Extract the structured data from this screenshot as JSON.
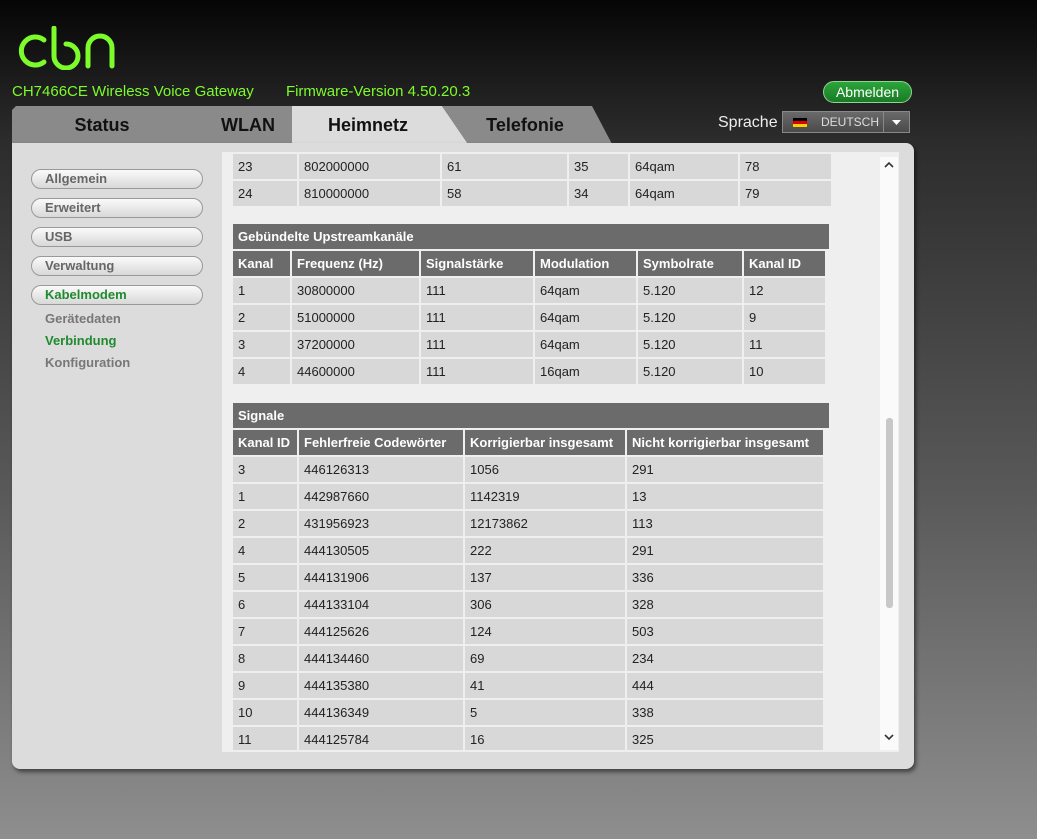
{
  "colors": {
    "brand": "#7cfc2a",
    "active_green": "#1f8a2e",
    "header_gray": "#6b6b6b",
    "cell_gray": "#d8d8d8"
  },
  "header": {
    "model": "CH7466CE  Wireless Voice Gateway",
    "firmware": "Firmware-Version  4.50.20.3",
    "logout_label": "Abmelden",
    "language_label": "Sprache",
    "language_value": "DEUTSCH",
    "flag_icon": "german-flag-icon"
  },
  "tabs": [
    {
      "label": "Status"
    },
    {
      "label": "WLAN"
    },
    {
      "label": "Heimnetz"
    },
    {
      "label": "Telefonie"
    }
  ],
  "sidebar": {
    "items": [
      {
        "label": "Allgemein"
      },
      {
        "label": "Erweitert"
      },
      {
        "label": "USB"
      },
      {
        "label": "Verwaltung"
      },
      {
        "label": "Kabelmodem"
      }
    ],
    "subitems": [
      {
        "label": "Gerätedaten"
      },
      {
        "label": "Verbindung"
      },
      {
        "label": "Konfiguration"
      }
    ]
  },
  "downstream_rows": [
    [
      "23",
      "802000000",
      "61",
      "35",
      "64qam",
      "78"
    ],
    [
      "24",
      "810000000",
      "58",
      "34",
      "64qam",
      "79"
    ]
  ],
  "upstream": {
    "caption": "Gebündelte Upstreamkanäle",
    "headers": [
      "Kanal",
      "Frequenz (Hz)",
      "Signalstärke",
      "Modulation",
      "Symbolrate",
      "Kanal ID"
    ],
    "rows": [
      [
        "1",
        "30800000",
        "111",
        "64qam",
        "5.120",
        "12"
      ],
      [
        "2",
        "51000000",
        "111",
        "64qam",
        "5.120",
        "9"
      ],
      [
        "3",
        "37200000",
        "111",
        "64qam",
        "5.120",
        "11"
      ],
      [
        "4",
        "44600000",
        "111",
        "16qam",
        "5.120",
        "10"
      ]
    ]
  },
  "signals": {
    "caption": "Signale",
    "headers": [
      "Kanal ID",
      "Fehlerfreie Codewörter",
      "Korrigierbar insgesamt",
      "Nicht korrigierbar insgesamt"
    ],
    "rows": [
      [
        "3",
        "446126313",
        "1056",
        "291"
      ],
      [
        "1",
        "442987660",
        "1142319",
        "13"
      ],
      [
        "2",
        "431956923",
        "12173862",
        "113"
      ],
      [
        "4",
        "444130505",
        "222",
        "291"
      ],
      [
        "5",
        "444131906",
        "137",
        "336"
      ],
      [
        "6",
        "444133104",
        "306",
        "328"
      ],
      [
        "7",
        "444125626",
        "124",
        "503"
      ],
      [
        "8",
        "444134460",
        "69",
        "234"
      ],
      [
        "9",
        "444135380",
        "41",
        "444"
      ],
      [
        "10",
        "444136349",
        "5",
        "338"
      ],
      [
        "11",
        "444125784",
        "16",
        "325"
      ]
    ]
  }
}
